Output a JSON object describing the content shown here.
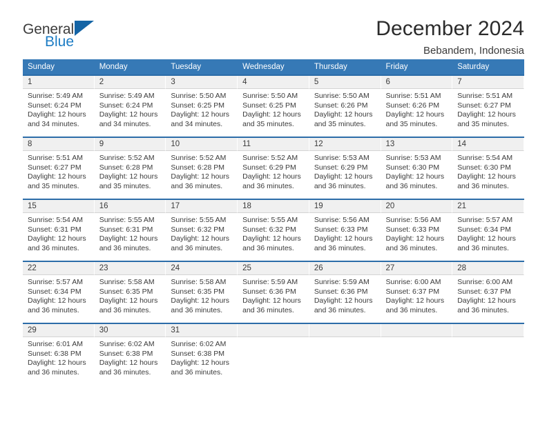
{
  "brand": {
    "name_part1": "General",
    "name_part2": "Blue",
    "logo_icon": "triangle-mark-icon"
  },
  "header": {
    "title": "December 2024",
    "location": "Bebandem, Indonesia"
  },
  "colors": {
    "header_blue": "#3679b6",
    "row_divider_blue": "#2b6ca8",
    "daynum_background": "#f0f0f0",
    "brand_blue": "#1c7cc4",
    "text": "#3a3a3a"
  },
  "calendar": {
    "weekday_headers": [
      "Sunday",
      "Monday",
      "Tuesday",
      "Wednesday",
      "Thursday",
      "Friday",
      "Saturday"
    ],
    "weeks": [
      [
        {
          "day": "1",
          "sunrise": "Sunrise: 5:49 AM",
          "sunset": "Sunset: 6:24 PM",
          "daylight": "Daylight: 12 hours and 34 minutes."
        },
        {
          "day": "2",
          "sunrise": "Sunrise: 5:49 AM",
          "sunset": "Sunset: 6:24 PM",
          "daylight": "Daylight: 12 hours and 34 minutes."
        },
        {
          "day": "3",
          "sunrise": "Sunrise: 5:50 AM",
          "sunset": "Sunset: 6:25 PM",
          "daylight": "Daylight: 12 hours and 34 minutes."
        },
        {
          "day": "4",
          "sunrise": "Sunrise: 5:50 AM",
          "sunset": "Sunset: 6:25 PM",
          "daylight": "Daylight: 12 hours and 35 minutes."
        },
        {
          "day": "5",
          "sunrise": "Sunrise: 5:50 AM",
          "sunset": "Sunset: 6:26 PM",
          "daylight": "Daylight: 12 hours and 35 minutes."
        },
        {
          "day": "6",
          "sunrise": "Sunrise: 5:51 AM",
          "sunset": "Sunset: 6:26 PM",
          "daylight": "Daylight: 12 hours and 35 minutes."
        },
        {
          "day": "7",
          "sunrise": "Sunrise: 5:51 AM",
          "sunset": "Sunset: 6:27 PM",
          "daylight": "Daylight: 12 hours and 35 minutes."
        }
      ],
      [
        {
          "day": "8",
          "sunrise": "Sunrise: 5:51 AM",
          "sunset": "Sunset: 6:27 PM",
          "daylight": "Daylight: 12 hours and 35 minutes."
        },
        {
          "day": "9",
          "sunrise": "Sunrise: 5:52 AM",
          "sunset": "Sunset: 6:28 PM",
          "daylight": "Daylight: 12 hours and 35 minutes."
        },
        {
          "day": "10",
          "sunrise": "Sunrise: 5:52 AM",
          "sunset": "Sunset: 6:28 PM",
          "daylight": "Daylight: 12 hours and 36 minutes."
        },
        {
          "day": "11",
          "sunrise": "Sunrise: 5:52 AM",
          "sunset": "Sunset: 6:29 PM",
          "daylight": "Daylight: 12 hours and 36 minutes."
        },
        {
          "day": "12",
          "sunrise": "Sunrise: 5:53 AM",
          "sunset": "Sunset: 6:29 PM",
          "daylight": "Daylight: 12 hours and 36 minutes."
        },
        {
          "day": "13",
          "sunrise": "Sunrise: 5:53 AM",
          "sunset": "Sunset: 6:30 PM",
          "daylight": "Daylight: 12 hours and 36 minutes."
        },
        {
          "day": "14",
          "sunrise": "Sunrise: 5:54 AM",
          "sunset": "Sunset: 6:30 PM",
          "daylight": "Daylight: 12 hours and 36 minutes."
        }
      ],
      [
        {
          "day": "15",
          "sunrise": "Sunrise: 5:54 AM",
          "sunset": "Sunset: 6:31 PM",
          "daylight": "Daylight: 12 hours and 36 minutes."
        },
        {
          "day": "16",
          "sunrise": "Sunrise: 5:55 AM",
          "sunset": "Sunset: 6:31 PM",
          "daylight": "Daylight: 12 hours and 36 minutes."
        },
        {
          "day": "17",
          "sunrise": "Sunrise: 5:55 AM",
          "sunset": "Sunset: 6:32 PM",
          "daylight": "Daylight: 12 hours and 36 minutes."
        },
        {
          "day": "18",
          "sunrise": "Sunrise: 5:55 AM",
          "sunset": "Sunset: 6:32 PM",
          "daylight": "Daylight: 12 hours and 36 minutes."
        },
        {
          "day": "19",
          "sunrise": "Sunrise: 5:56 AM",
          "sunset": "Sunset: 6:33 PM",
          "daylight": "Daylight: 12 hours and 36 minutes."
        },
        {
          "day": "20",
          "sunrise": "Sunrise: 5:56 AM",
          "sunset": "Sunset: 6:33 PM",
          "daylight": "Daylight: 12 hours and 36 minutes."
        },
        {
          "day": "21",
          "sunrise": "Sunrise: 5:57 AM",
          "sunset": "Sunset: 6:34 PM",
          "daylight": "Daylight: 12 hours and 36 minutes."
        }
      ],
      [
        {
          "day": "22",
          "sunrise": "Sunrise: 5:57 AM",
          "sunset": "Sunset: 6:34 PM",
          "daylight": "Daylight: 12 hours and 36 minutes."
        },
        {
          "day": "23",
          "sunrise": "Sunrise: 5:58 AM",
          "sunset": "Sunset: 6:35 PM",
          "daylight": "Daylight: 12 hours and 36 minutes."
        },
        {
          "day": "24",
          "sunrise": "Sunrise: 5:58 AM",
          "sunset": "Sunset: 6:35 PM",
          "daylight": "Daylight: 12 hours and 36 minutes."
        },
        {
          "day": "25",
          "sunrise": "Sunrise: 5:59 AM",
          "sunset": "Sunset: 6:36 PM",
          "daylight": "Daylight: 12 hours and 36 minutes."
        },
        {
          "day": "26",
          "sunrise": "Sunrise: 5:59 AM",
          "sunset": "Sunset: 6:36 PM",
          "daylight": "Daylight: 12 hours and 36 minutes."
        },
        {
          "day": "27",
          "sunrise": "Sunrise: 6:00 AM",
          "sunset": "Sunset: 6:37 PM",
          "daylight": "Daylight: 12 hours and 36 minutes."
        },
        {
          "day": "28",
          "sunrise": "Sunrise: 6:00 AM",
          "sunset": "Sunset: 6:37 PM",
          "daylight": "Daylight: 12 hours and 36 minutes."
        }
      ],
      [
        {
          "day": "29",
          "sunrise": "Sunrise: 6:01 AM",
          "sunset": "Sunset: 6:38 PM",
          "daylight": "Daylight: 12 hours and 36 minutes."
        },
        {
          "day": "30",
          "sunrise": "Sunrise: 6:02 AM",
          "sunset": "Sunset: 6:38 PM",
          "daylight": "Daylight: 12 hours and 36 minutes."
        },
        {
          "day": "31",
          "sunrise": "Sunrise: 6:02 AM",
          "sunset": "Sunset: 6:38 PM",
          "daylight": "Daylight: 12 hours and 36 minutes."
        },
        {
          "day": "",
          "sunrise": "",
          "sunset": "",
          "daylight": ""
        },
        {
          "day": "",
          "sunrise": "",
          "sunset": "",
          "daylight": ""
        },
        {
          "day": "",
          "sunrise": "",
          "sunset": "",
          "daylight": ""
        },
        {
          "day": "",
          "sunrise": "",
          "sunset": "",
          "daylight": ""
        }
      ]
    ]
  }
}
